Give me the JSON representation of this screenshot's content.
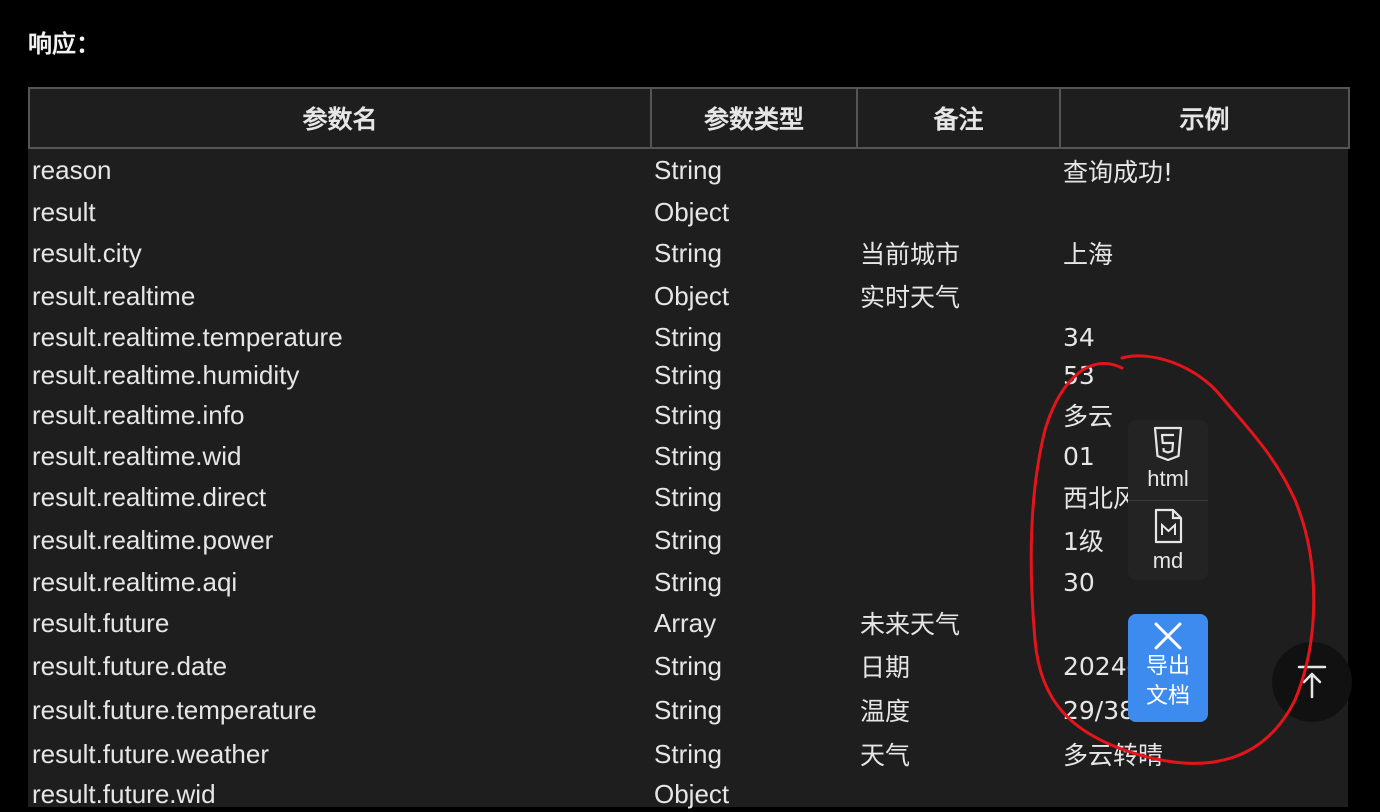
{
  "section_title": "响应：",
  "table": {
    "headers": [
      "参数名",
      "参数类型",
      "备注",
      "示例"
    ],
    "rows": [
      [
        "reason",
        "String",
        "",
        "查询成功!"
      ],
      [
        "result",
        "Object",
        "",
        ""
      ],
      [
        "result.city",
        "String",
        "当前城市",
        "上海"
      ],
      [
        "result.realtime",
        "Object",
        "实时天气",
        ""
      ],
      [
        "result.realtime.temperature",
        "String",
        "",
        "34"
      ],
      [
        "result.realtime.humidity",
        "String",
        "",
        "53"
      ],
      [
        "result.realtime.info",
        "String",
        "",
        "多云"
      ],
      [
        "result.realtime.wid",
        "String",
        "",
        "01"
      ],
      [
        "result.realtime.direct",
        "String",
        "",
        "西北风"
      ],
      [
        "result.realtime.power",
        "String",
        "",
        "1级"
      ],
      [
        "result.realtime.aqi",
        "String",
        "",
        "30"
      ],
      [
        "result.future",
        "Array",
        "未来天气",
        ""
      ],
      [
        "result.future.date",
        "String",
        "日期",
        "2024-07-26"
      ],
      [
        "result.future.temperature",
        "String",
        "温度",
        "29/38℃"
      ],
      [
        "result.future.weather",
        "String",
        "天气",
        "多云转晴"
      ],
      [
        "result.future.wid",
        "Object",
        "",
        ""
      ]
    ]
  },
  "export_menu": {
    "items": [
      {
        "label": "html",
        "icon": "html5-icon"
      },
      {
        "label": "md",
        "icon": "markdown-file-icon"
      }
    ],
    "button_label": "导出\n文档",
    "button_icon": "close-icon",
    "accent": "#3d8bef"
  },
  "back_to_top_icon": "arrow-up-to-top-icon",
  "annotation_color": "#e5141b"
}
